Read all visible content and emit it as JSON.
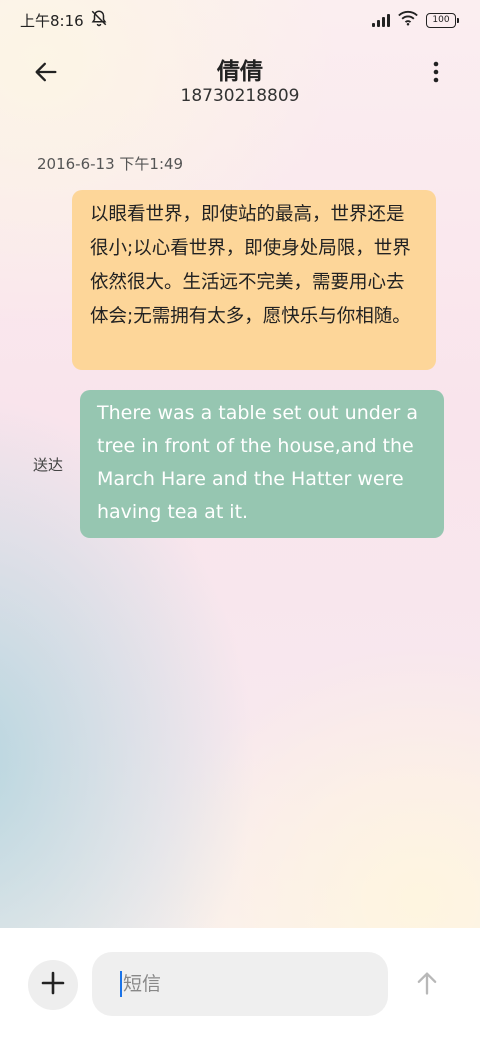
{
  "status_bar": {
    "time": "上午8:16",
    "battery": "100",
    "icons": [
      "mute-alarm-icon",
      "signal-icon",
      "wifi-icon",
      "battery-icon"
    ]
  },
  "header": {
    "contact_name": "倩倩",
    "contact_number": "18730218809",
    "icons": [
      "back-arrow-icon",
      "more-vertical-icon"
    ]
  },
  "conversation": {
    "timestamp": "2016-6-13 下午1:49",
    "messages": [
      {
        "direction": "received",
        "text": "以眼看世界，即使站的最高，世界还是很小;以心看世界，即使身处局限，世界依然很大。生活远不完美，需要用心去体会;无需拥有太多，愿快乐与你相随。",
        "color": "#fdd699"
      },
      {
        "direction": "sent",
        "text": "There was a table set out under a tree in front of the house,and the March Hare and the Hatter were having tea at it.",
        "status": "送达",
        "color": "#96c6b1"
      }
    ]
  },
  "composer": {
    "placeholder": "短信",
    "value": "",
    "icons": [
      "plus-icon",
      "send-arrow-icon"
    ]
  },
  "colors": {
    "accent": "#1a73e8",
    "received_bubble": "#fdd699",
    "sent_bubble": "#96c6b1"
  }
}
